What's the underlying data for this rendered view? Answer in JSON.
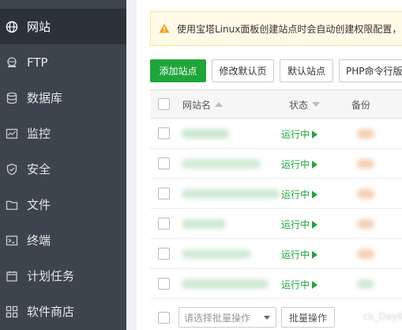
{
  "sidebar": {
    "items": [
      {
        "label": "网站",
        "icon": "globe-icon",
        "active": true
      },
      {
        "label": "FTP",
        "icon": "ftp-icon",
        "active": false
      },
      {
        "label": "数据库",
        "icon": "database-icon",
        "active": false
      },
      {
        "label": "监控",
        "icon": "monitor-icon",
        "active": false
      },
      {
        "label": "安全",
        "icon": "shield-icon",
        "active": false
      },
      {
        "label": "文件",
        "icon": "folder-icon",
        "active": false
      },
      {
        "label": "终端",
        "icon": "terminal-icon",
        "active": false
      },
      {
        "label": "计划任务",
        "icon": "calendar-icon",
        "active": false
      },
      {
        "label": "软件商店",
        "icon": "apps-icon",
        "active": false
      }
    ]
  },
  "notice": {
    "text": "使用宝塔Linux面板创建站点时会自动创建权限配置，"
  },
  "toolbar": {
    "add_site": "添加站点",
    "edit_default_page": "修改默认页",
    "default_site": "默认站点",
    "php_cli": "PHP命令行版"
  },
  "table": {
    "headers": {
      "name": "网站名",
      "status": "状态",
      "backup": "备份"
    },
    "rows": [
      {
        "status": "运行中"
      },
      {
        "status": "运行中"
      },
      {
        "status": "运行中"
      },
      {
        "status": "运行中"
      },
      {
        "status": "运行中"
      },
      {
        "status": "运行中"
      }
    ]
  },
  "footer": {
    "batch_select_placeholder": "请选择批量操作",
    "batch_button": "批量操作"
  },
  "watermark": "ck_Day666",
  "colors": {
    "sidebar_bg": "#3c444d",
    "sidebar_active_bg": "#2c3338",
    "accent_green": "#20a53a",
    "notice_bg": "#fffbe6",
    "warning_orange": "#f0a020"
  }
}
